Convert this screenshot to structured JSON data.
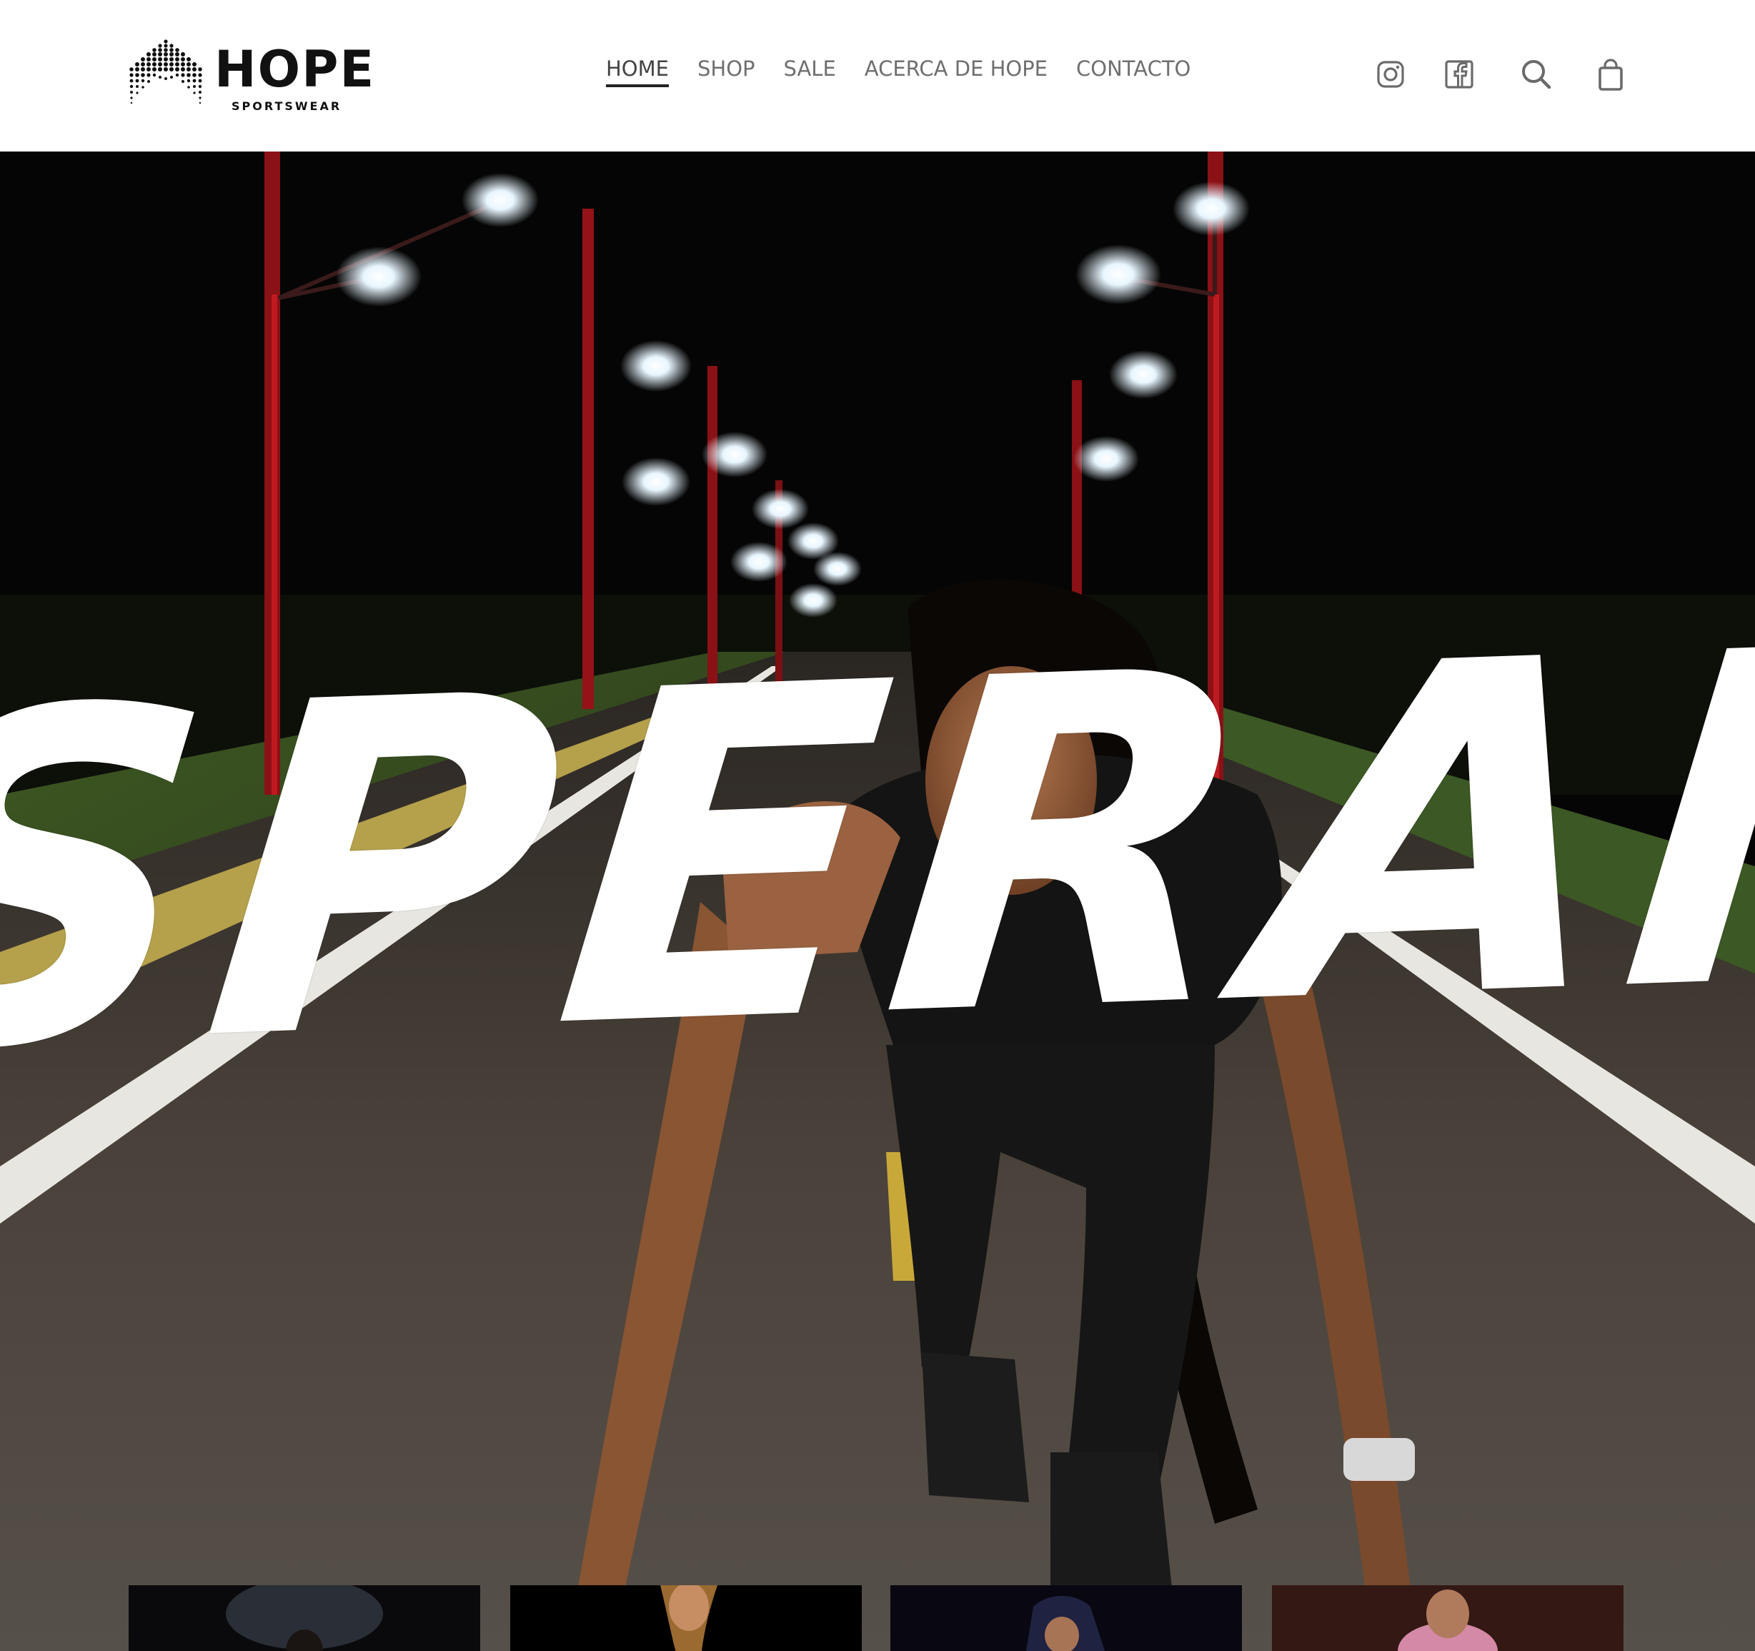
{
  "brand": {
    "name": "HOPE",
    "tagline": "SPORTSWEAR"
  },
  "nav": {
    "items": [
      {
        "label": "HOME",
        "active": true
      },
      {
        "label": "SHOP",
        "active": false
      },
      {
        "label": "SALE",
        "active": false
      },
      {
        "label": "ACERCA DE HOPE",
        "active": false
      },
      {
        "label": "CONTACTO",
        "active": false
      }
    ]
  },
  "header_icons": [
    "instagram-icon",
    "facebook-icon",
    "search-icon",
    "shopping-bag-icon"
  ],
  "hero": {
    "title_visible": "SPERANZ"
  },
  "colors": {
    "header_bg": "#ffffff",
    "nav_text": "#6f6f6f",
    "nav_active_underline": "#222222",
    "hero_title": "#ffffff",
    "street_light_pole": "#b3151c"
  }
}
